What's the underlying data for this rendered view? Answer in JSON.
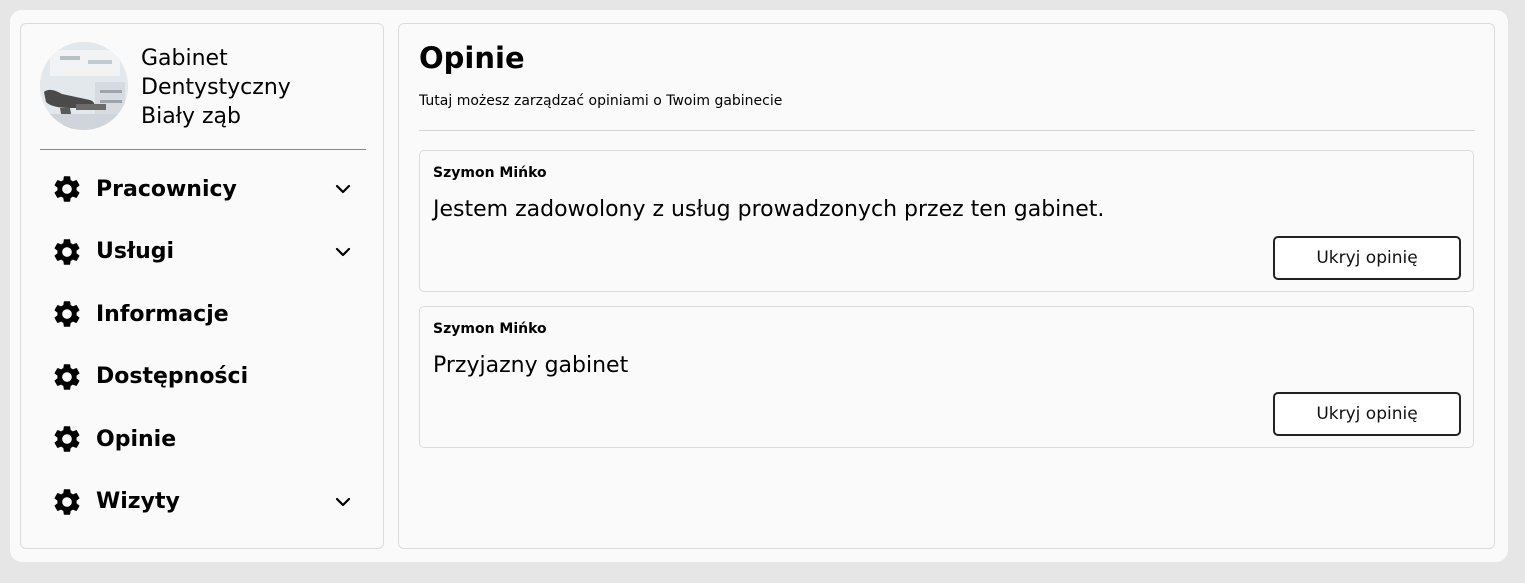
{
  "brand": {
    "name_lines": [
      "Gabinet",
      "Dentystyczny",
      "Biały ząb"
    ]
  },
  "sidebar": {
    "items": [
      {
        "label": "Pracownicy",
        "icon": "gear-icon",
        "has_dropdown": true
      },
      {
        "label": "Usługi",
        "icon": "gear-icon",
        "has_dropdown": true
      },
      {
        "label": "Informacje",
        "icon": "gear-icon",
        "has_dropdown": false
      },
      {
        "label": "Dostępności",
        "icon": "gear-icon",
        "has_dropdown": false
      },
      {
        "label": "Opinie",
        "icon": "gear-icon",
        "has_dropdown": false
      },
      {
        "label": "Wizyty",
        "icon": "gear-icon",
        "has_dropdown": true
      }
    ]
  },
  "main": {
    "title": "Opinie",
    "subtitle": "Tutaj możesz zarządzać opiniami o Twoim gabinecie",
    "reviews": [
      {
        "author": "Szymon Mińko",
        "text": "Jestem zadowolony z usług prowadzonych przez ten gabinet.",
        "button_label": "Ukryj opinię"
      },
      {
        "author": "Szymon Mińko",
        "text": "Przyjazny gabinet",
        "button_label": "Ukryj opinię"
      }
    ]
  }
}
